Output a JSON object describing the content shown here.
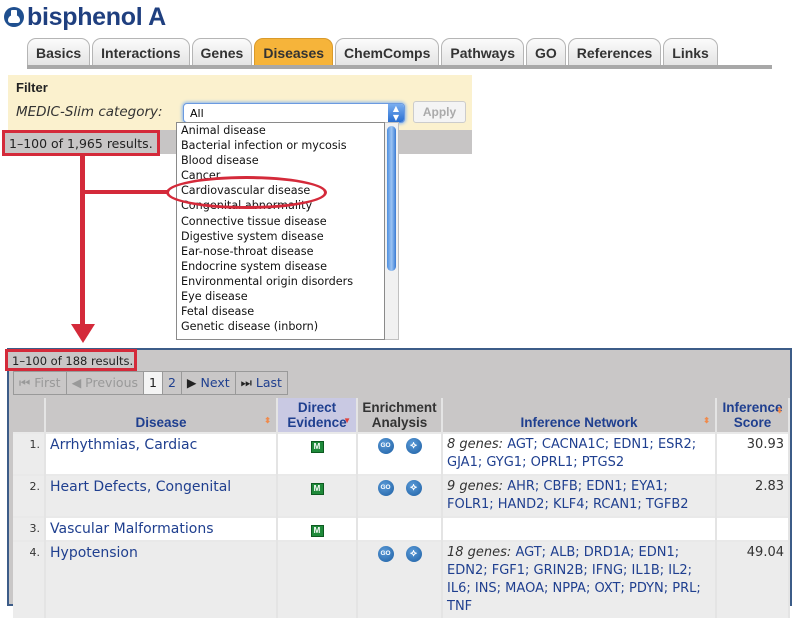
{
  "title": "bisphenol A",
  "tabs": [
    {
      "label": "Basics",
      "active": false
    },
    {
      "label": "Interactions",
      "active": false
    },
    {
      "label": "Genes",
      "active": false
    },
    {
      "label": "Diseases",
      "active": true
    },
    {
      "label": "ChemComps",
      "active": false
    },
    {
      "label": "Pathways",
      "active": false
    },
    {
      "label": "GO",
      "active": false
    },
    {
      "label": "References",
      "active": false
    },
    {
      "label": "Links",
      "active": false
    }
  ],
  "filter": {
    "heading": "Filter",
    "category_label": "MEDIC-Slim category:",
    "selected": "All",
    "apply_label": "Apply",
    "options": [
      "Animal disease",
      "Bacterial infection or mycosis",
      "Blood disease",
      "Cancer",
      "Cardiovascular disease",
      "Congenital abnormality",
      "Connective tissue disease",
      "Digestive system disease",
      "Ear-nose-throat disease",
      "Endocrine system disease",
      "Environmental origin disorders",
      "Eye disease",
      "Fetal disease",
      "Genetic disease (inborn)"
    ],
    "highlighted_option": "Cardiovascular disease"
  },
  "before": {
    "results_count": "1–100 of 1,965 results."
  },
  "after": {
    "results_count": "1–100 of 188 results.",
    "pager": {
      "first": "First",
      "previous": "Previous",
      "pages": [
        "1",
        "2"
      ],
      "current_page": "1",
      "next": "Next",
      "last": "Last"
    },
    "columns": {
      "disease": "Disease",
      "direct_evidence_1": "Direct",
      "direct_evidence_2": "Evidence",
      "enrichment_1": "Enrichment",
      "enrichment_2": "Analysis",
      "inference_network": "Inference Network",
      "inference_score_1": "Inference",
      "inference_score_2": "Score"
    },
    "rows": [
      {
        "num": "1.",
        "disease": "Arrhythmias, Cardiac",
        "direct_evidence": "M",
        "enrichment": true,
        "genes_label": "8 genes:",
        "genes": "AGT; CACNA1C; EDN1; ESR2; GJA1; GYG1; OPRL1; PTGS2",
        "score": "30.93"
      },
      {
        "num": "2.",
        "disease": "Heart Defects, Congenital",
        "direct_evidence": "M",
        "enrichment": true,
        "genes_label": "9 genes:",
        "genes": "AHR; CBFB; EDN1; EYA1; FOLR1; HAND2; KLF4; RCAN1; TGFB2",
        "score": "2.83"
      },
      {
        "num": "3.",
        "disease": "Vascular Malformations",
        "direct_evidence": "M",
        "enrichment": false,
        "genes_label": "",
        "genes": "",
        "score": ""
      },
      {
        "num": "4.",
        "disease": "Hypotension",
        "direct_evidence": "",
        "enrichment": true,
        "genes_label": "18 genes:",
        "genes": "AGT; ALB; DRD1A; EDN1; EDN2; FGF1; GRIN2B; IFNG; IL1B; IL2; IL6; INS; MAOA; NPPA; OXT; PDYN; PRL; TNF",
        "score": "49.04"
      }
    ],
    "icons": {
      "direct_evidence": "M",
      "go": "GO",
      "network": "network-icon"
    }
  },
  "colors": {
    "accent_tab": "#f6b43a",
    "annotation_red": "#d42a3a",
    "link_blue": "#1f3f8f",
    "filter_bg": "#fbf1ce"
  }
}
